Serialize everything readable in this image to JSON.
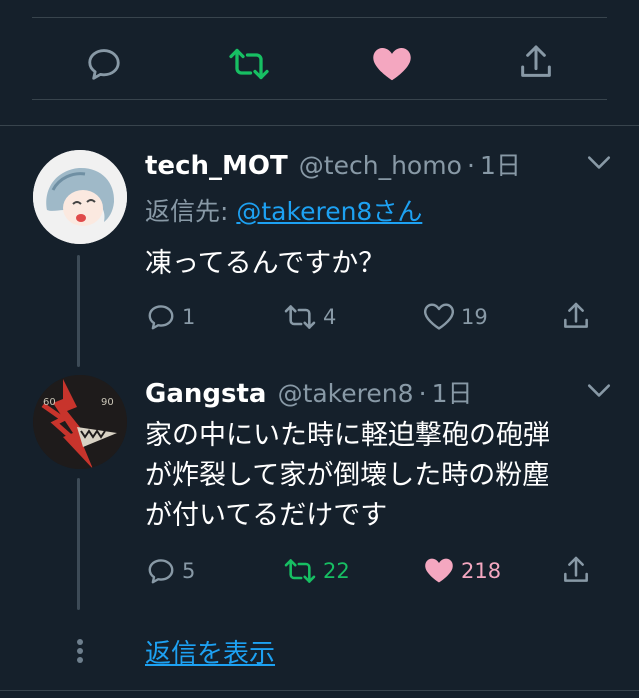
{
  "top_actions": {
    "reply_icon": "reply-icon",
    "retweet_icon": "retweet-icon",
    "like_icon": "heart-icon",
    "share_icon": "share-icon"
  },
  "tweet1": {
    "display_name": "tech_MOT",
    "handle": "@tech_homo",
    "dot": "·",
    "time": "1日",
    "reply_prefix": "返信先: ",
    "reply_to": "@takeren8さん",
    "text": "凍ってるんですか？",
    "reply_count": "1",
    "retweet_count": "4",
    "like_count": "19"
  },
  "tweet2": {
    "display_name": "Gangsta",
    "handle": "@takeren8",
    "dot": "·",
    "time": "1日",
    "text_lines": [
      "家の中にいた時に軽迫撃砲の砲弾",
      "が炸裂して家が倒壊した時の粉塵",
      "が付いてるだけです"
    ],
    "avatar_labels": [
      "60",
      "90"
    ],
    "reply_count": "5",
    "retweet_count": "22",
    "like_count": "218"
  },
  "show_replies_label": "返信を表示",
  "colors": {
    "background": "#15202b",
    "divider": "#38444d",
    "muted": "#8899a6",
    "link": "#1da1f2",
    "retweet_active": "#17bf63",
    "like_active": "#e0245e",
    "like_pink": "#f4a7c0"
  }
}
